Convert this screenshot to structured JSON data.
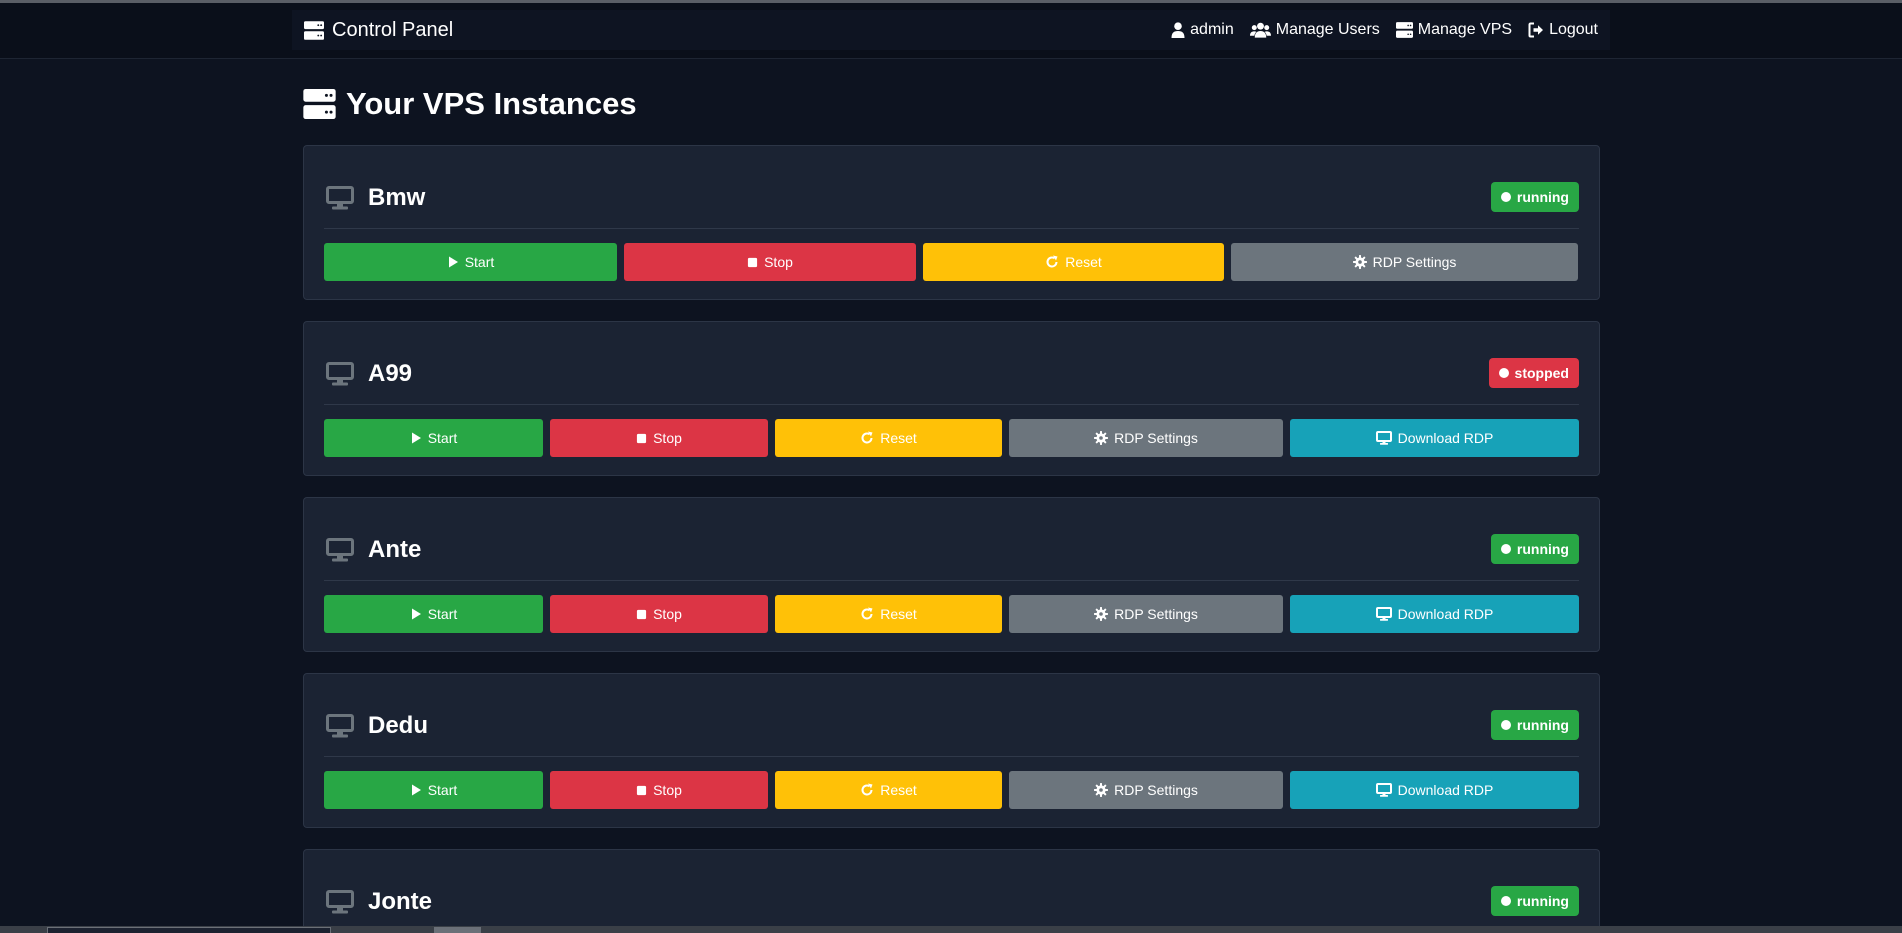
{
  "navbar": {
    "brand": "Control Panel",
    "brand_icon": "server-icon",
    "links": [
      {
        "label": "admin",
        "icon": "user-icon"
      },
      {
        "label": "Manage Users",
        "icon": "users-icon"
      },
      {
        "label": "Manage VPS",
        "icon": "server-icon"
      },
      {
        "label": "Logout",
        "icon": "logout-icon"
      }
    ]
  },
  "page": {
    "title": "Your VPS Instances"
  },
  "buttons": {
    "start": "Start",
    "stop": "Stop",
    "reset": "Reset",
    "rdp_settings": "RDP Settings",
    "download_rdp": "Download RDP"
  },
  "instances": [
    {
      "name": "Bmw",
      "status": "running"
    },
    {
      "name": "A99",
      "status": "stopped"
    },
    {
      "name": "Ante",
      "status": "running"
    },
    {
      "name": "Dedu",
      "status": "running"
    },
    {
      "name": "Jonte",
      "status": "running"
    }
  ],
  "colors": {
    "background": "#0d1320",
    "card": "#1b2333",
    "start": "#28a745",
    "stop": "#dc3545",
    "reset": "#ffc107",
    "rdp_settings": "#6c757d",
    "download_rdp": "#17a2b8",
    "badge_running": "#28a745",
    "badge_stopped": "#dc3545"
  }
}
